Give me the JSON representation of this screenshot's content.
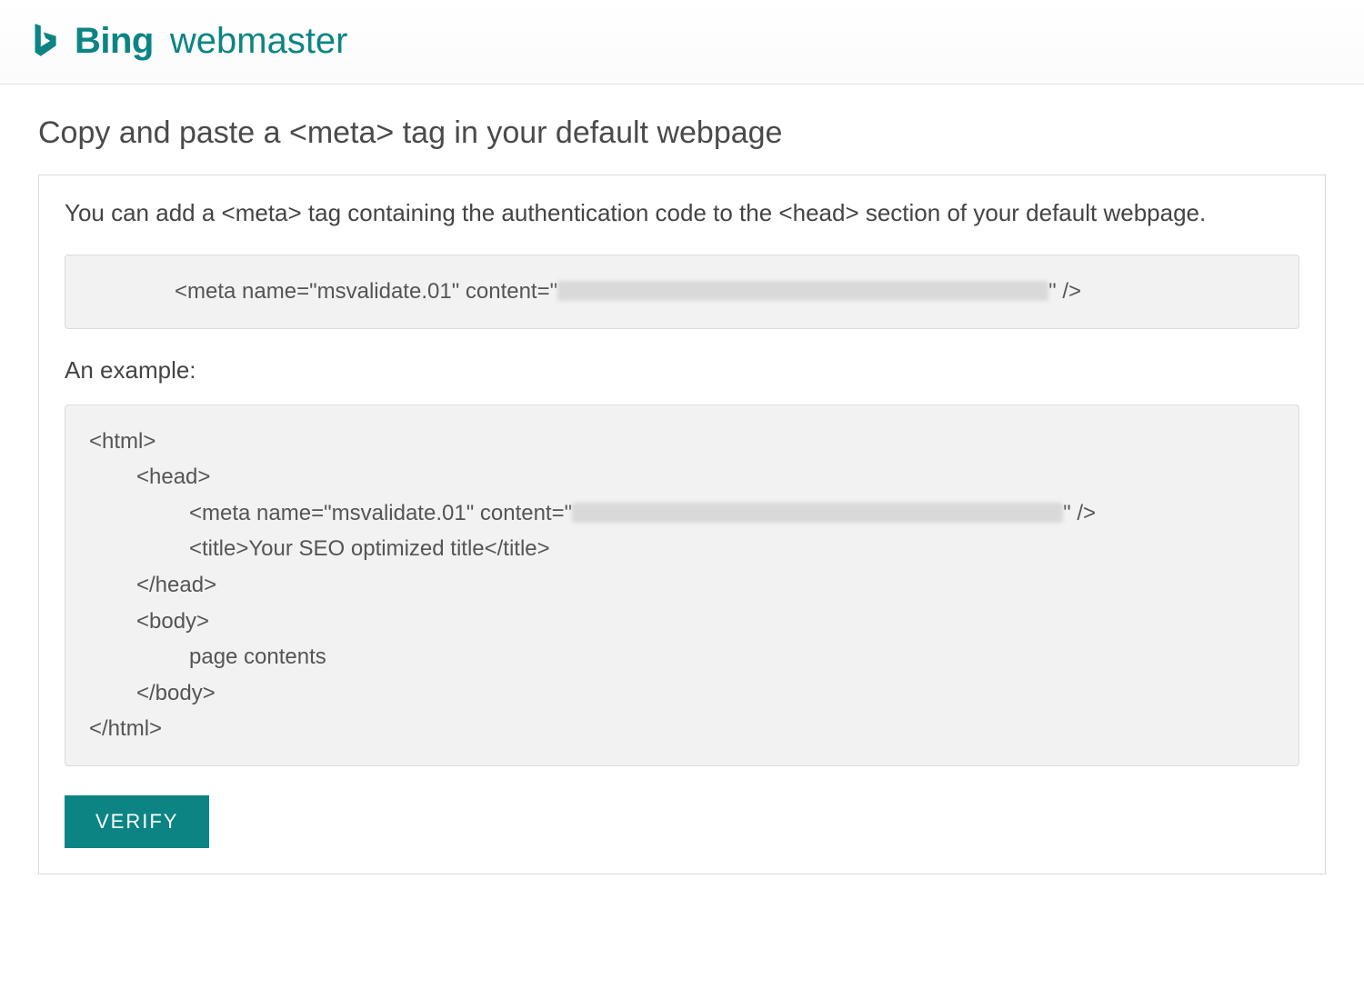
{
  "header": {
    "brand": "Bing",
    "product": "webmaster"
  },
  "page": {
    "title": "Copy and paste a <meta> tag in your default webpage",
    "description": "You can add a <meta> tag containing the authentication code to the <head> section of your default webpage.",
    "meta_snippet_prefix": "<meta name=\"msvalidate.01\" content=\"",
    "meta_snippet_suffix": "\" />",
    "example_label": "An example:",
    "example": {
      "line1": "<html>",
      "line2": "<head>",
      "line3_prefix": "<meta name=\"msvalidate.01\" content=\"",
      "line3_suffix": "\" />",
      "line4": "<title>Your SEO optimized title</title>",
      "line5": "</head>",
      "line6": "<body>",
      "line7": "page contents",
      "line8": "</body>",
      "line9": "</html>"
    },
    "verify_label": "VERIFY"
  },
  "colors": {
    "brand_teal": "#0c8484"
  }
}
